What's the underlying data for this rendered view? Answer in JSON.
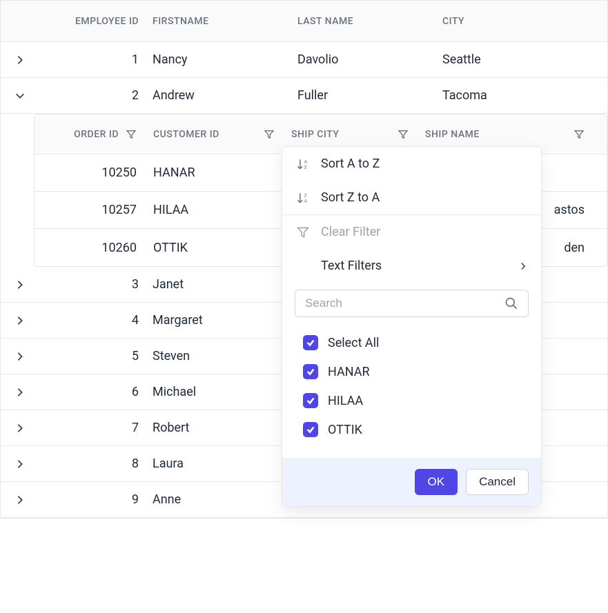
{
  "header": {
    "employee_id": "EMPLOYEE ID",
    "firstname": "FIRSTNAME",
    "lastname": "LAST NAME",
    "city": "CITY"
  },
  "rows": [
    {
      "id": "1",
      "firstname": "Nancy",
      "lastname": "Davolio",
      "city": "Seattle",
      "expanded": false
    },
    {
      "id": "2",
      "firstname": "Andrew",
      "lastname": "Fuller",
      "city": "Tacoma",
      "expanded": true
    },
    {
      "id": "3",
      "firstname": "Janet",
      "lastname": "",
      "city": "",
      "expanded": false
    },
    {
      "id": "4",
      "firstname": "Margaret",
      "lastname": "",
      "city": "",
      "expanded": false
    },
    {
      "id": "5",
      "firstname": "Steven",
      "lastname": "",
      "city": "",
      "expanded": false
    },
    {
      "id": "6",
      "firstname": "Michael",
      "lastname": "",
      "city": "",
      "expanded": false
    },
    {
      "id": "7",
      "firstname": "Robert",
      "lastname": "",
      "city": "",
      "expanded": false
    },
    {
      "id": "8",
      "firstname": "Laura",
      "lastname": "",
      "city": "",
      "expanded": false
    },
    {
      "id": "9",
      "firstname": "Anne",
      "lastname": "",
      "city": "",
      "expanded": false
    }
  ],
  "nested_header": {
    "order_id": "ORDER ID",
    "customer_id": "CUSTOMER ID",
    "ship_city": "SHIP CITY",
    "ship_name": "SHIP NAME"
  },
  "nested_rows": [
    {
      "order_id": "10250",
      "customer_id": "HANAR",
      "ship_city": "",
      "ship_name": ""
    },
    {
      "order_id": "10257",
      "customer_id": "HILAA",
      "ship_city": "",
      "ship_name": "astos"
    },
    {
      "order_id": "10260",
      "customer_id": "OTTIK",
      "ship_city": "",
      "ship_name": "den"
    }
  ],
  "popup": {
    "sort_az": "Sort A to Z",
    "sort_za": "Sort Z to A",
    "clear_filter": "Clear Filter",
    "text_filters": "Text Filters",
    "search_placeholder": "Search",
    "select_all": "Select All",
    "options": [
      "HANAR",
      "HILAA",
      "OTTIK"
    ],
    "ok": "OK",
    "cancel": "Cancel"
  }
}
